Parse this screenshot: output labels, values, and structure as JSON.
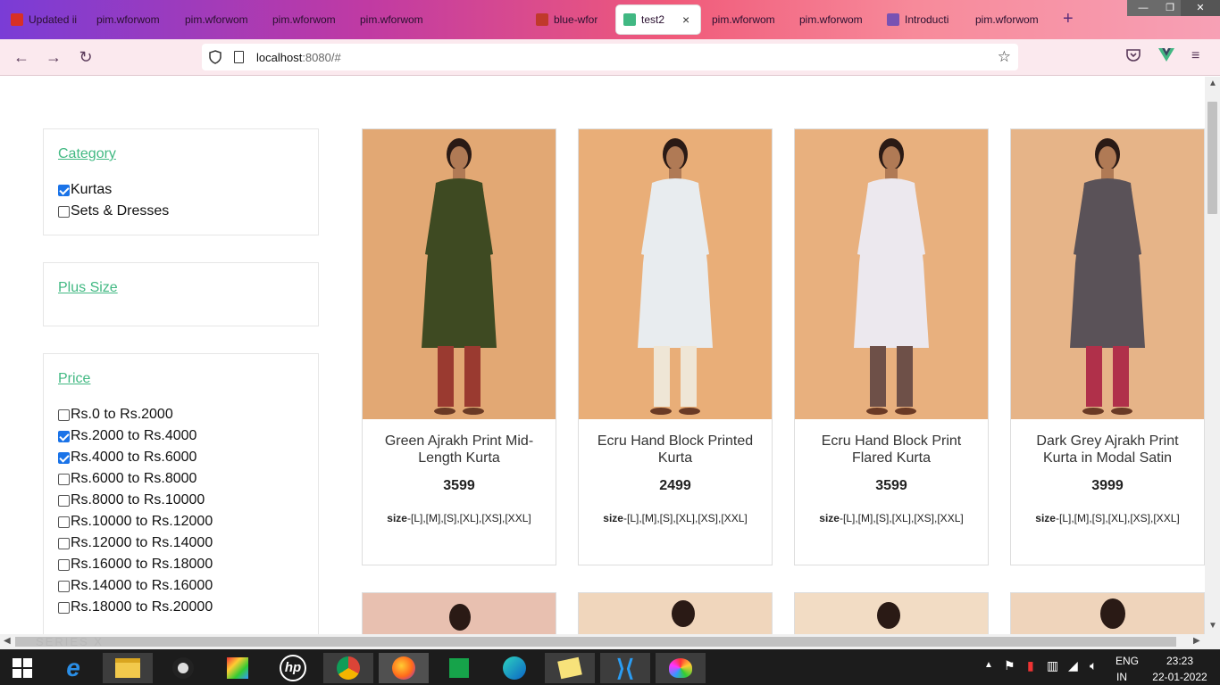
{
  "browser": {
    "tabs": [
      {
        "title": "Updated ii",
        "icon": "gmail-icon"
      },
      {
        "title": "pim.wforwom",
        "icon": ""
      },
      {
        "title": "pim.wforwom",
        "icon": ""
      },
      {
        "title": "pim.wforwom",
        "icon": ""
      },
      {
        "title": "pim.wforwom",
        "icon": ""
      },
      {
        "title": "blue-wfor",
        "icon": "w-brand-icon"
      },
      {
        "title": "test2",
        "icon": "vue-icon",
        "active": true
      },
      {
        "title": "pim.wforwom",
        "icon": ""
      },
      {
        "title": "pim.wforwom",
        "icon": ""
      },
      {
        "title": "Introducti",
        "icon": "bootstrap-icon"
      },
      {
        "title": "pim.wforwom",
        "icon": ""
      }
    ],
    "close_tab": "×",
    "new_tab": "+",
    "url_host": "localhost",
    "url_rest": ":8080/#"
  },
  "filters": {
    "category": {
      "title": "Category",
      "options": [
        {
          "label": "Kurtas",
          "checked": true
        },
        {
          "label": "Sets & Dresses",
          "checked": false
        }
      ]
    },
    "plus_size": {
      "title": "Plus Size"
    },
    "price": {
      "title": "Price",
      "options": [
        {
          "label": "Rs.0 to Rs.2000",
          "checked": false
        },
        {
          "label": "Rs.2000 to Rs.4000",
          "checked": true
        },
        {
          "label": "Rs.4000 to Rs.6000",
          "checked": true
        },
        {
          "label": "Rs.6000 to Rs.8000",
          "checked": false
        },
        {
          "label": "Rs.8000 to Rs.10000",
          "checked": false
        },
        {
          "label": "Rs.10000 to Rs.12000",
          "checked": false
        },
        {
          "label": "Rs.12000 to Rs.14000",
          "checked": false
        },
        {
          "label": "Rs.16000 to Rs.18000",
          "checked": false
        },
        {
          "label": "Rs.14000 to Rs.16000",
          "checked": false
        },
        {
          "label": "Rs.18000 to Rs.20000",
          "checked": false
        }
      ]
    }
  },
  "products": [
    {
      "name": "Green Ajrakh Print Mid-Length Kurta",
      "price": "3599",
      "size_label": "size",
      "sizes": "-[L],[M],[S],[XL],[XS],[XXL]",
      "color": "#3e4a22",
      "pants": "#9a3a30"
    },
    {
      "name": "Ecru Hand Block Printed Kurta",
      "price": "2499",
      "size_label": "size",
      "sizes": "-[L],[M],[S],[XL],[XS],[XXL]",
      "color": "#e8ecef",
      "pants": "#efe6d6"
    },
    {
      "name": "Ecru Hand Block Print Flared Kurta",
      "price": "3599",
      "size_label": "size",
      "sizes": "-[L],[M],[S],[XL],[XS],[XXL]",
      "color": "#ece8ee",
      "pants": "#6e5048"
    },
    {
      "name": "Dark Grey Ajrakh Print Kurta in Modal Satin",
      "price": "3999",
      "size_label": "size",
      "sizes": "-[L],[M],[S],[XL],[XS],[XXL]",
      "color": "#5a5258",
      "pants": "#b0304a"
    }
  ],
  "taskbar": {
    "lang_top": "ENG",
    "lang_bottom": "IN",
    "time": "23:23",
    "date": "22-01-2022",
    "watermark": "SERIES X"
  }
}
